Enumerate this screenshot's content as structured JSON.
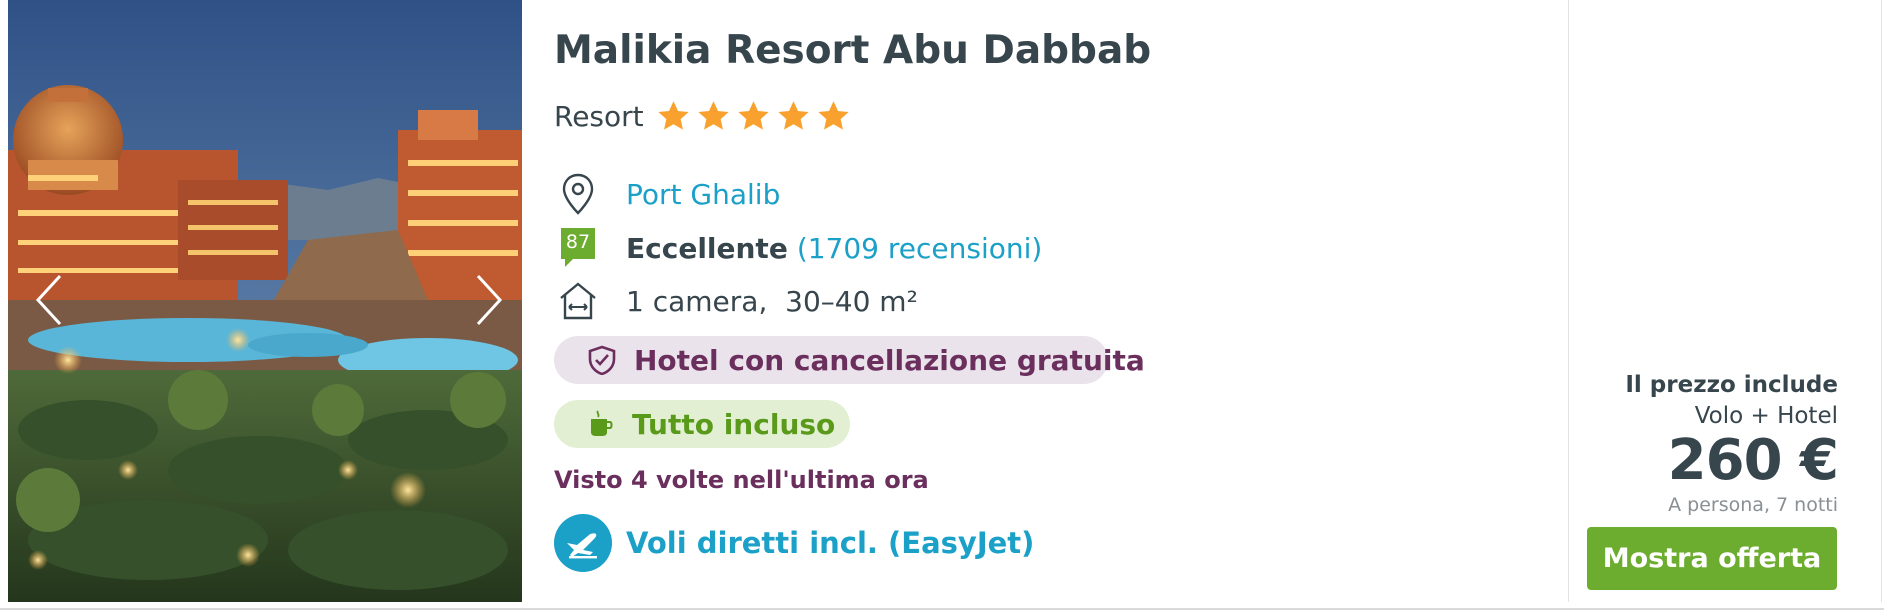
{
  "hotel": {
    "name": "Malikia Resort Abu Dabbab",
    "category": "Resort",
    "stars": 5,
    "location": "Port Ghalib",
    "rating": {
      "score": "87",
      "label": "Eccellente",
      "reviews": "(1709 recensioni)"
    },
    "room": "1 camera,  30–40 m²",
    "free_cancellation": "Hotel con cancellazione gratuita",
    "board": "Tutto incluso",
    "viewed": "Visto 4 volte nell'ultima ora",
    "flight": "Voli diretti incl. (EasyJet)"
  },
  "gallery": {
    "prev_icon": "chevron-left-icon",
    "next_icon": "chevron-right-icon"
  },
  "price": {
    "includes_label": "Il prezzo include",
    "package": "Volo + Hotel",
    "amount": "260 €",
    "note": "A persona, 7 notti",
    "cta": "Mostra offerta"
  },
  "colors": {
    "title": "#37454d",
    "link": "#1ba0c8",
    "star": "#f9a12e",
    "rating_badge": "#6cad2f",
    "cancel_pill_bg": "#ebe3eb",
    "cancel_text": "#6b2f5d",
    "allinc_pill_bg": "#e2efd2",
    "allinc_text": "#5a9a1a",
    "cta_bg": "#6cad2f"
  }
}
